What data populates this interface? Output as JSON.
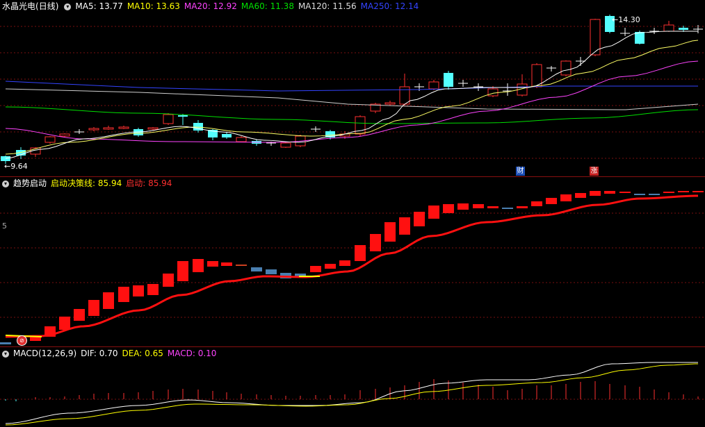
{
  "price_panel": {
    "stock_name": "水晶光电",
    "period": "(日线)",
    "ma_labels": [
      {
        "text": "MA5: 13.77",
        "color": "#ffffff"
      },
      {
        "text": "MA10: 13.63",
        "color": "#ffff00"
      },
      {
        "text": "MA20: 12.92",
        "color": "#ff44ff"
      },
      {
        "text": "MA60: 11.38",
        "color": "#00e000"
      },
      {
        "text": "MA120: 11.56",
        "color": "#dddddd"
      },
      {
        "text": "MA250: 12.14",
        "color": "#3344ff"
      }
    ],
    "high_label": "14.30",
    "low_label": "9.64",
    "event_tags": [
      {
        "text": "财",
        "color": "#2255cc"
      },
      {
        "text": "涨",
        "color": "#cc2222"
      }
    ]
  },
  "indicator_panel": {
    "name": "趋势启动",
    "line1_label": "启动决策线: 85.94",
    "line2_label": "启动: 85.94",
    "axis_label": "5"
  },
  "macd_panel": {
    "name": "MACD(12,26,9)",
    "dif_label": "DIF: 0.70",
    "dea_label": "DEA: 0.65",
    "macd_label": "MACD: 0.10"
  },
  "colors": {
    "up": "#ff3030",
    "down": "#54ffff",
    "grid": "#7a1010",
    "steel": "#4a7fb0"
  }
}
